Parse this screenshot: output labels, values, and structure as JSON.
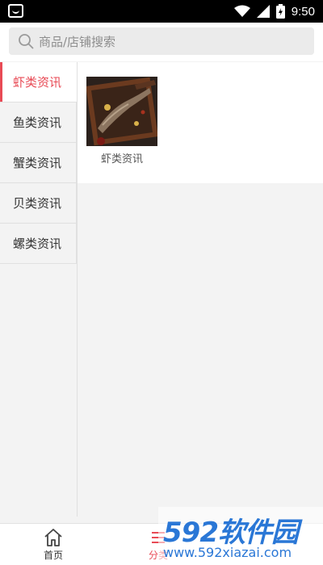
{
  "status_bar": {
    "time": "9:50",
    "icons": [
      "wifi-icon",
      "signal-icon",
      "battery-charging-icon"
    ]
  },
  "search": {
    "placeholder": "商品/店铺搜索",
    "icon": "search-icon"
  },
  "sidebar": {
    "items": [
      {
        "label": "虾类资讯",
        "active": true
      },
      {
        "label": "鱼类资讯",
        "active": false
      },
      {
        "label": "蟹类资讯",
        "active": false
      },
      {
        "label": "贝类资讯",
        "active": false
      },
      {
        "label": "螺类资讯",
        "active": false
      }
    ]
  },
  "content": {
    "cards": [
      {
        "label": "虾类资讯",
        "image": "crayfish-photo"
      }
    ]
  },
  "bottom_nav": {
    "items": [
      {
        "label": "首页",
        "icon": "home-icon"
      },
      {
        "label": "分类",
        "icon": "category-icon",
        "active": true
      }
    ]
  },
  "watermark": {
    "brand_digits": "592",
    "brand_text": "软件园",
    "url": "www.592xiazai.com"
  },
  "colors": {
    "accent": "#e84a55",
    "watermark": "#2a77d6"
  }
}
